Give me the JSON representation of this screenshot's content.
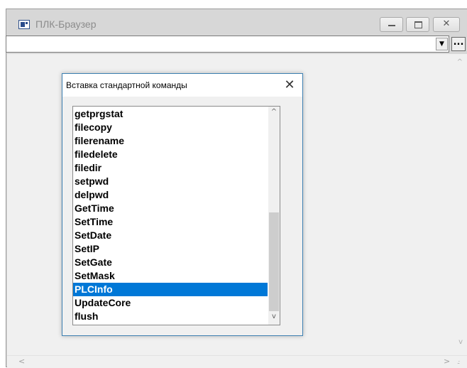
{
  "window": {
    "title": "ПЛК-Браузер",
    "address_value": "",
    "browse_label": "...",
    "icons": [
      "app-icon",
      "minimize-icon",
      "maximize-icon",
      "close-icon",
      "dropdown-arrow-icon"
    ]
  },
  "dialog": {
    "title": "Вставка стандартной команды",
    "close_glyph": "✕",
    "list": {
      "items": [
        "getprgstat",
        "filecopy",
        "filerename",
        "filedelete",
        "filedir",
        "setpwd",
        "delpwd",
        "GetTime",
        "SetTime",
        "SetDate",
        "SetIP",
        "SetGate",
        "SetMask",
        "PLCInfo",
        "UpdateCore",
        "flush"
      ],
      "selected": "PLCInfo",
      "selected_color": "#0078d7"
    }
  }
}
